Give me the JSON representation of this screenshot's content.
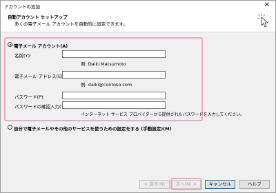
{
  "window": {
    "title": "アカウントの追加"
  },
  "header": {
    "title": "自動アカウント セットアップ",
    "subtitle": "多くの電子メール アカウントを自動的に設定できます。"
  },
  "email_account_option": {
    "label": "電子メール アカウント(A)",
    "selected": true,
    "fields": {
      "name": {
        "label": "名前(Y):",
        "value": "",
        "hint": "例: Daiki Matsumoto"
      },
      "email": {
        "label": "電子メール アドレス(E):",
        "value": "",
        "hint": "例: daiki@contoso.com"
      },
      "password": {
        "label": "パスワード(P):",
        "value": ""
      },
      "password_confirm": {
        "label": "パスワードの確認入力(T):",
        "value": "",
        "hint": "インターネット サービス プロバイダーから提供されたパスワードを入力してください。"
      }
    }
  },
  "manual_option": {
    "label": "自分で電子メールやその他のサービスを使うための設定をする (手動設定)(M)",
    "selected": false
  },
  "buttons": {
    "back": "< 戻る(B)",
    "next": "次へ(N) >",
    "cancel": "キャンセル",
    "help": "ヘルプ"
  },
  "colors": {
    "highlight": "#f1a7c6",
    "window_bg": "#f0f0f0"
  }
}
